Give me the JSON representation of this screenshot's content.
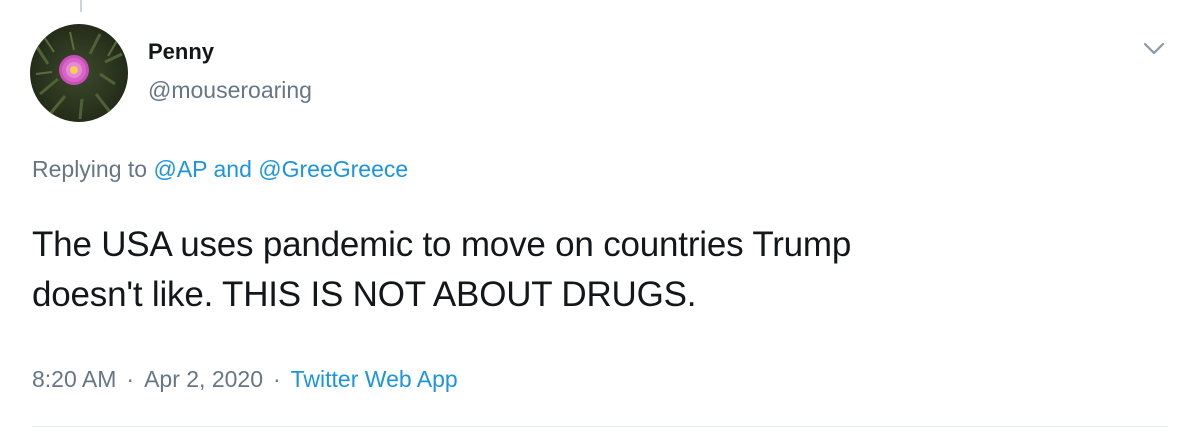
{
  "user": {
    "display_name": "Penny",
    "handle": "@mouseroaring"
  },
  "reply": {
    "prefix": "Replying to",
    "mention_1": "@AP",
    "conjunction": "and",
    "mention_2": "@GreeGreece"
  },
  "tweet": {
    "line_1": "The USA uses pandemic to move on countries Trump",
    "line_2": "doesn't like. THIS IS NOT ABOUT DRUGS."
  },
  "meta": {
    "time": "8:20 AM",
    "date": "Apr 2, 2020",
    "source": "Twitter Web App",
    "separator": "·"
  },
  "icons": {
    "avatar": "flower-avatar",
    "caret": "chevron-down-icon"
  },
  "colors": {
    "link": "#1b95e0",
    "secondary_text": "#657786",
    "primary_text": "#14171a"
  }
}
